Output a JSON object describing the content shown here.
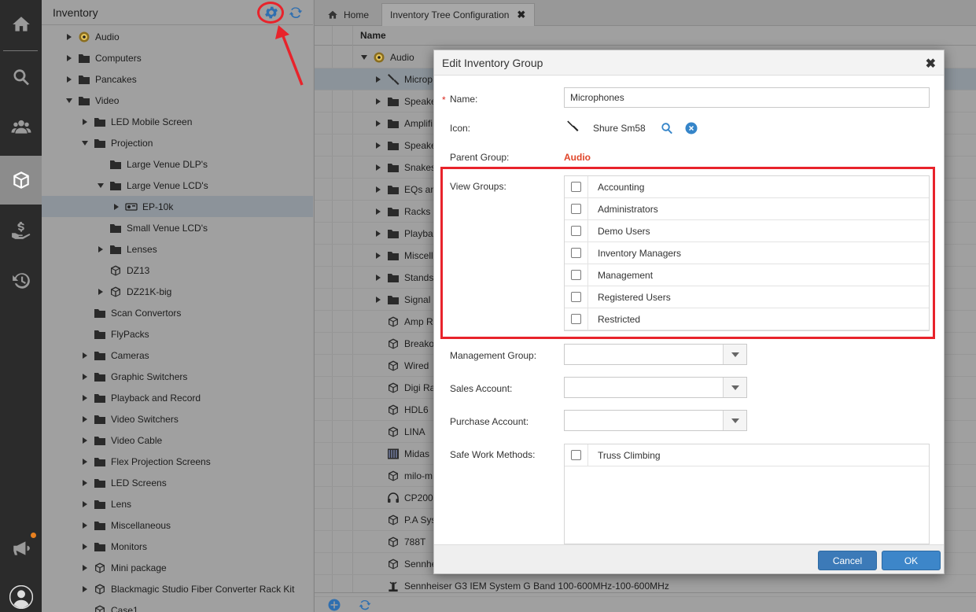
{
  "colors": {
    "accent": "#3d86c9",
    "required": "#d9281e",
    "parent_link": "#e0462a",
    "annotation": "#e8232b"
  },
  "rail": {
    "items": [
      {
        "icon": "home-icon"
      },
      {
        "icon": "search-icon"
      },
      {
        "icon": "users-icon"
      },
      {
        "icon": "box-icon"
      },
      {
        "icon": "hand-money-icon"
      },
      {
        "icon": "history-icon"
      },
      {
        "icon": "megaphone-icon"
      },
      {
        "icon": "user-avatar-icon"
      }
    ]
  },
  "tree": {
    "title": "Inventory",
    "items": [
      {
        "label": "Audio",
        "caret": "right",
        "icon": "speaker"
      },
      {
        "label": "Computers",
        "caret": "right",
        "icon": "folder"
      },
      {
        "label": "Pancakes",
        "caret": "right",
        "icon": "folder"
      },
      {
        "label": "Video",
        "caret": "down",
        "icon": "folder"
      },
      {
        "label": "LED Mobile Screen",
        "caret": "right",
        "icon": "folder"
      },
      {
        "label": "Projection",
        "caret": "down",
        "icon": "folder"
      },
      {
        "label": "Large Venue DLP's",
        "caret": "none",
        "icon": "folder"
      },
      {
        "label": "Large Venue LCD's",
        "caret": "down",
        "icon": "folder"
      },
      {
        "label": "EP-10k",
        "caret": "right",
        "icon": "projector"
      },
      {
        "label": "Small Venue LCD's",
        "caret": "none",
        "icon": "folder"
      },
      {
        "label": "Lenses",
        "caret": "right",
        "icon": "folder"
      },
      {
        "label": "DZ13",
        "caret": "none",
        "icon": "cube"
      },
      {
        "label": "DZ21K-big",
        "caret": "right",
        "icon": "cube"
      },
      {
        "label": "Scan Convertors",
        "caret": "none",
        "icon": "folder"
      },
      {
        "label": "FlyPacks",
        "caret": "none",
        "icon": "folder"
      },
      {
        "label": "Cameras",
        "caret": "right",
        "icon": "folder"
      },
      {
        "label": "Graphic Switchers",
        "caret": "right",
        "icon": "folder"
      },
      {
        "label": "Playback and Record",
        "caret": "right",
        "icon": "folder"
      },
      {
        "label": "Video Switchers",
        "caret": "right",
        "icon": "folder"
      },
      {
        "label": "Video Cable",
        "caret": "right",
        "icon": "folder"
      },
      {
        "label": "Flex Projection Screens",
        "caret": "right",
        "icon": "folder"
      },
      {
        "label": "LED Screens",
        "caret": "right",
        "icon": "folder"
      },
      {
        "label": "Lens",
        "caret": "right",
        "icon": "folder"
      },
      {
        "label": "Miscellaneous",
        "caret": "right",
        "icon": "folder"
      },
      {
        "label": "Monitors",
        "caret": "right",
        "icon": "folder"
      },
      {
        "label": "Mini package",
        "caret": "right",
        "icon": "cube"
      },
      {
        "label": "Blackmagic Studio Fiber Converter Rack Kit",
        "caret": "right",
        "icon": "cube"
      },
      {
        "label": "Case1",
        "caret": "none",
        "icon": "cube"
      }
    ]
  },
  "tabs": [
    {
      "label": "Home",
      "icon": "home-icon"
    },
    {
      "label": "Inventory Tree Configuration",
      "close": "✖"
    }
  ],
  "grid": {
    "column_name": "Name",
    "rows": [
      {
        "label": "Audio",
        "caret": "down",
        "icon": "speaker"
      },
      {
        "label": "Microp",
        "caret": "right",
        "icon": "mic"
      },
      {
        "label": "Speake",
        "caret": "right",
        "icon": "folder"
      },
      {
        "label": "Amplifi",
        "caret": "right",
        "icon": "folder"
      },
      {
        "label": "Speake",
        "caret": "right",
        "icon": "folder"
      },
      {
        "label": "Snakes",
        "caret": "right",
        "icon": "folder"
      },
      {
        "label": "EQs an",
        "caret": "right",
        "icon": "folder"
      },
      {
        "label": "Racks",
        "caret": "right",
        "icon": "folder"
      },
      {
        "label": "Playba",
        "caret": "right",
        "icon": "folder"
      },
      {
        "label": "Miscell",
        "caret": "right",
        "icon": "folder"
      },
      {
        "label": "Stands",
        "caret": "right",
        "icon": "folder"
      },
      {
        "label": "Signal C",
        "caret": "right",
        "icon": "folder"
      },
      {
        "label": "Amp Ra",
        "caret": "none",
        "icon": "cube"
      },
      {
        "label": "Breako",
        "caret": "none",
        "icon": "cube"
      },
      {
        "label": "Wired",
        "caret": "none",
        "icon": "cube"
      },
      {
        "label": "Digi Ra",
        "caret": "none",
        "icon": "cube"
      },
      {
        "label": "HDL6",
        "caret": "none",
        "icon": "cube"
      },
      {
        "label": "LINA",
        "caret": "none",
        "icon": "cube"
      },
      {
        "label": "Midas",
        "caret": "none",
        "icon": "mixer"
      },
      {
        "label": "milo-m",
        "caret": "none",
        "icon": "cube"
      },
      {
        "label": "CP200",
        "caret": "none",
        "icon": "headphones"
      },
      {
        "label": "P.A Sys",
        "caret": "none",
        "icon": "cube"
      },
      {
        "label": "788T",
        "caret": "none",
        "icon": "cube"
      },
      {
        "label": "Sennhe",
        "caret": "none",
        "icon": "cube"
      },
      {
        "label": "Sennheiser G3 IEM System G Band 100-600MHz-100-600MHz",
        "caret": "none",
        "icon": "iem"
      }
    ]
  },
  "dialog": {
    "title": "Edit Inventory Group",
    "close": "✖",
    "name_label": "Name:",
    "required_mark": "*",
    "name_value": "Microphones",
    "icon_label": "Icon:",
    "icon_value": "Shure Sm58",
    "parent_label": "Parent Group:",
    "parent_value": "Audio",
    "view_groups_label": "View Groups:",
    "view_groups": [
      "Accounting",
      "Administrators",
      "Demo Users",
      "Inventory Managers",
      "Management",
      "Registered Users",
      "Restricted"
    ],
    "management_group_label": "Management Group:",
    "sales_account_label": "Sales Account:",
    "purchase_account_label": "Purchase Account:",
    "safe_work_label": "Safe Work Methods:",
    "safe_work_methods": [
      "Truss Climbing"
    ],
    "cancel_label": "Cancel",
    "ok_label": "OK"
  }
}
